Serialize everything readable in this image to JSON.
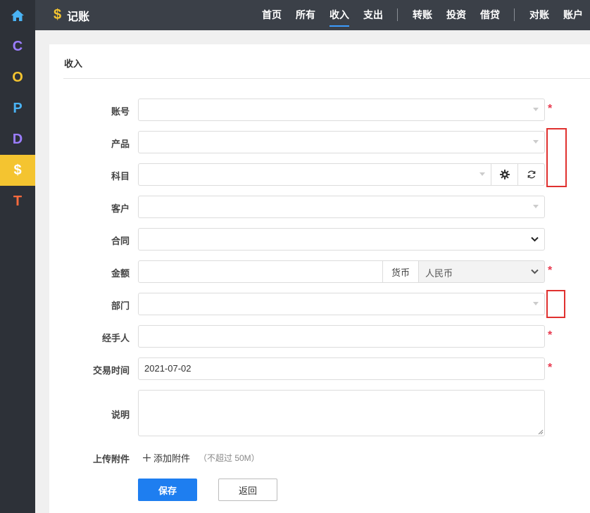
{
  "rail": {
    "items": [
      {
        "name": "home",
        "glyph": "⌂",
        "color": "#4ab3f4"
      },
      {
        "name": "c",
        "glyph": "C",
        "color": "#9b7dff"
      },
      {
        "name": "o",
        "glyph": "O",
        "color": "#f4c430"
      },
      {
        "name": "p",
        "glyph": "P",
        "color": "#4ab3f4"
      },
      {
        "name": "d",
        "glyph": "D",
        "color": "#9b7dff"
      },
      {
        "name": "dollar",
        "glyph": "$",
        "color": "#ffffff"
      },
      {
        "name": "t",
        "glyph": "T",
        "color": "#ff6a3d"
      }
    ]
  },
  "topbar": {
    "app_icon": "$",
    "app_title": "记账",
    "nav": [
      "首页",
      "所有",
      "收入",
      "支出",
      "转账",
      "投资",
      "借贷",
      "对账",
      "账户"
    ],
    "active_nav": "收入"
  },
  "card": {
    "title": "收入"
  },
  "form": {
    "account_label": "账号",
    "product_label": "产品",
    "subject_label": "科目",
    "customer_label": "客户",
    "contract_label": "合同",
    "amount_label": "金额",
    "currency_addon": "货币",
    "currency_value": "人民币",
    "department_label": "部门",
    "handler_label": "经手人",
    "trade_time_label": "交易时间",
    "trade_time_value": "2021-07-02",
    "description_label": "说明",
    "attachment_label": "上传附件",
    "add_attachment": "添加附件",
    "attachment_limit": "（不超过 50M）",
    "required_mark": "*",
    "save": "保存",
    "back": "返回"
  },
  "colors": {
    "primary": "#1e7ef0",
    "required": "#e83a4f",
    "highlight": "#e0312f"
  }
}
